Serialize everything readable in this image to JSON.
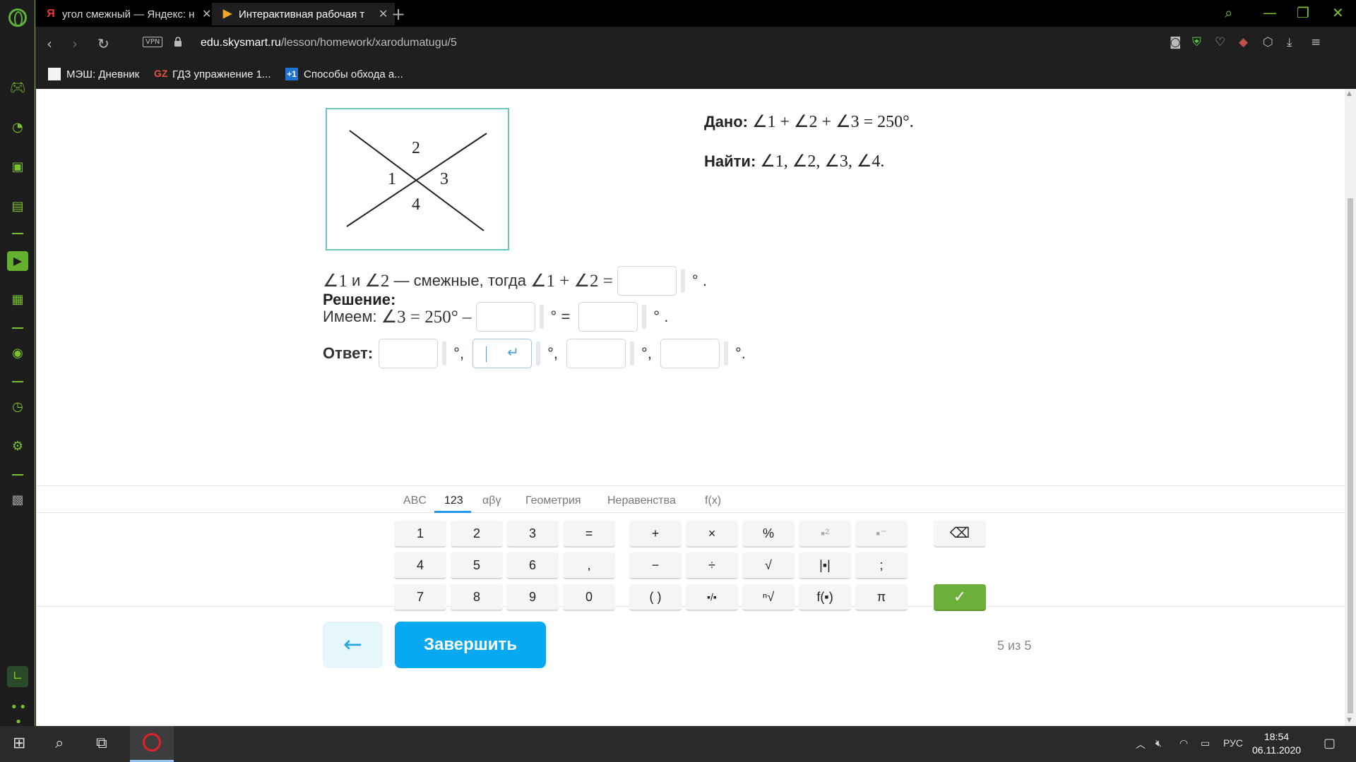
{
  "browser": {
    "tabs": [
      {
        "favicon": "Я",
        "title": "угол смежный — Яндекс: н",
        "active": false
      },
      {
        "favicon": "▶",
        "title": "Интерактивная рабочая т",
        "active": true
      }
    ],
    "url_domain": "edu.skysmart.ru",
    "url_path": "/lesson/homework/xarodumatugu/5",
    "vpn_label": "VPN",
    "bookmarks": [
      {
        "label": "МЭШ: Дневник"
      },
      {
        "label": "ГДЗ упражнение 1..."
      },
      {
        "label": "Способы обхода а..."
      }
    ]
  },
  "task": {
    "given_label": "Дано:",
    "given_expr": "∠1 + ∠2 + ∠3 = 250°.",
    "find_label": "Найти:",
    "find_expr": "∠1, ∠2, ∠3, ∠4.",
    "figure_labels": [
      "1",
      "2",
      "3",
      "4"
    ]
  },
  "solution": {
    "title": "Решение:",
    "line1_expr_a": "∠1",
    "line1_text_a": " и ",
    "line1_expr_b": "∠2",
    "line1_text_b": " — смежные, тогда ",
    "line1_expr_c": "∠1 + ∠2 =",
    "line1_end": "° .",
    "line2_text": "Имеем: ",
    "line2_expr": "∠3 = 250° –",
    "line2_mid": "° =",
    "line2_end": "° .",
    "answer_label": "Ответ:",
    "sep": "°,",
    "answer_end": "°."
  },
  "keyboard": {
    "tabs": [
      "ABC",
      "123",
      "αβγ",
      "Геометрия",
      "Неравенства",
      "f(x)"
    ],
    "active_tab": "123",
    "row1": [
      "1",
      "2",
      "3",
      "=",
      "+",
      "×",
      "%",
      "▪²",
      "▪⁻"
    ],
    "row2": [
      "4",
      "5",
      "6",
      ",",
      "−",
      "÷",
      "√",
      "|▪|",
      ";"
    ],
    "row3": [
      "7",
      "8",
      "9",
      "0",
      "( )",
      "▪/▪",
      "ⁿ√",
      "f(▪)",
      "π"
    ],
    "backspace": "⌫",
    "confirm": "✓"
  },
  "navigation": {
    "back_icon": "←",
    "finish_label": "Завершить",
    "progress": "5 из 5"
  },
  "taskbar": {
    "lang": "РУС",
    "time": "18:54",
    "date": "06.11.2020"
  },
  "colors": {
    "accent_blue": "#08a9f3",
    "opera_green": "#79c12f",
    "confirm_green": "#6cb03b",
    "figure_border": "#6cc2c4"
  }
}
